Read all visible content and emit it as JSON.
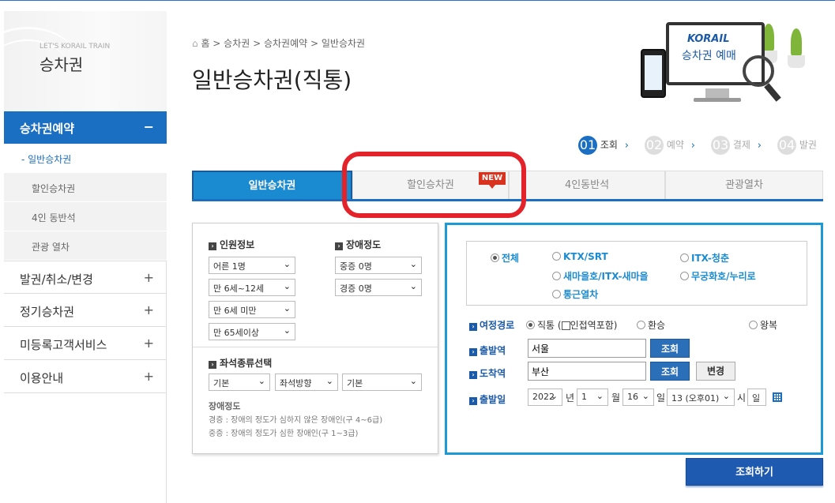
{
  "sidebar": {
    "subtitle": "LET'S KORAIL TRAIN",
    "title": "승차권",
    "active_menu": {
      "label": "승차권예약",
      "toggle": "−"
    },
    "sub_items": [
      {
        "label": "- 일반승차권"
      },
      {
        "label": "할인승차권"
      },
      {
        "label": "4인 동반석"
      },
      {
        "label": "관광 열차"
      }
    ],
    "menu": [
      {
        "label": "발권/취소/변경",
        "toggle": "+"
      },
      {
        "label": "정기승차권",
        "toggle": "+"
      },
      {
        "label": "미등록고객서비스",
        "toggle": "+"
      },
      {
        "label": "이용안내",
        "toggle": "+"
      }
    ]
  },
  "header": {
    "breadcrumb": "홈 > 승차권 > 승차권예약 > 일반승차권",
    "title": "일반승차권(직통)",
    "promo_brand": "KORAIL",
    "promo_text": "승차권 예매"
  },
  "steps": [
    {
      "num": "01",
      "label": "조회"
    },
    {
      "num": "02",
      "label": "예약"
    },
    {
      "num": "03",
      "label": "결제"
    },
    {
      "num": "04",
      "label": "발권"
    }
  ],
  "tabs": [
    "일반승차권",
    "할인승차권",
    "4인동반석",
    "관광열차"
  ],
  "new_badge": "NEW",
  "passengers": {
    "title": "인원정보",
    "selects": [
      "어른 1명",
      "만 6세~12세",
      "만 6세 미만",
      "만 65세이상"
    ]
  },
  "disability": {
    "title": "장애정도",
    "selects": [
      "중증 0명",
      "경증 0명"
    ]
  },
  "seat": {
    "title": "좌석종류선택",
    "selects": [
      "기본",
      "좌석방향",
      "기본"
    ]
  },
  "notes": {
    "title": "장애정도",
    "lines": [
      "경증 : 장애의 정도가 심하지 않은 장애인(구 4~6급)",
      "중증 : 장애의 정도가 심한 장애인(구 1~3급)"
    ]
  },
  "train_types": [
    {
      "label": "전체",
      "checked": true
    },
    {
      "label": "KTX/SRT",
      "checked": false
    },
    {
      "label": "ITX-청춘",
      "checked": false
    },
    {
      "label": "새마을호/ITX-새마을",
      "checked": false
    },
    {
      "label": "무궁화호/누리로",
      "checked": false
    },
    {
      "label": "통근열차",
      "checked": false
    }
  ],
  "route": {
    "label": "여정경로",
    "direct": "직통 (",
    "transfer_check": "인접역포함)",
    "transfer": "환승",
    "round_trip": "왕복"
  },
  "departure": {
    "label": "출발역",
    "value": "서울",
    "button": "조회"
  },
  "arrival": {
    "label": "도착역",
    "value": "부산",
    "button": "조회",
    "swap": "변경"
  },
  "date": {
    "label": "출발일",
    "year": "2022",
    "year_unit": "년",
    "month": "1",
    "month_unit": "월",
    "day": "16",
    "day_unit": "일",
    "hour": "13 (오후01)",
    "hour_unit": "시",
    "minute_unit": "일"
  },
  "search_button": "조회하기"
}
